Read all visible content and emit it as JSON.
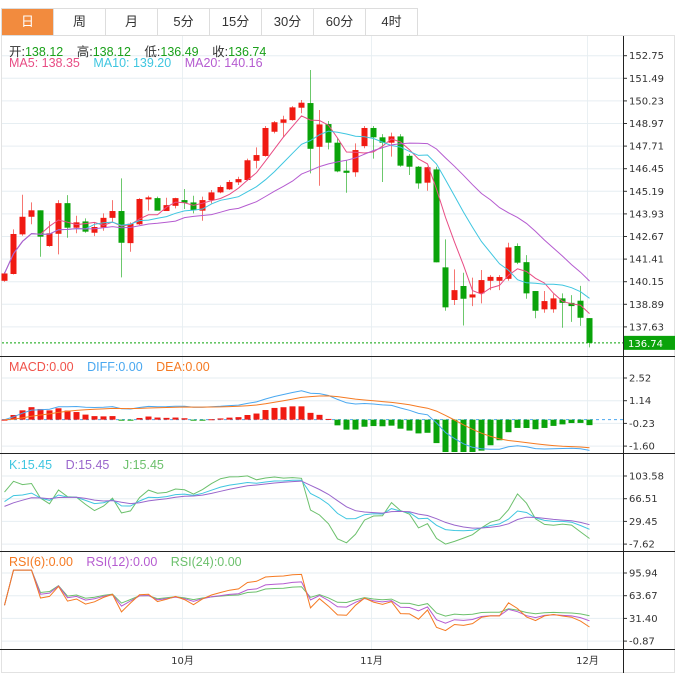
{
  "tabs": [
    {
      "label": "日",
      "active": true
    },
    {
      "label": "周",
      "active": false
    },
    {
      "label": "月",
      "active": false
    },
    {
      "label": "5分",
      "active": false
    },
    {
      "label": "15分",
      "active": false
    },
    {
      "label": "30分",
      "active": false
    },
    {
      "label": "60分",
      "active": false
    },
    {
      "label": "4时",
      "active": false
    }
  ],
  "ohlc_legend": {
    "open_label": "开:",
    "open": "138.12",
    "high_label": "高:",
    "high": "138.12",
    "low_label": "低:",
    "low": "136.49",
    "close_label": "收:",
    "close": "136.74"
  },
  "ma_legend": {
    "ma5": "MA5: 138.35",
    "ma10": "MA10: 139.20",
    "ma20": "MA20: 140.16"
  },
  "macd_legend": {
    "macd": "MACD:0.00",
    "diff": "DIFF:0.00",
    "dea": "DEA:0.00"
  },
  "kdj_legend": {
    "k": "K:15.45",
    "d": "D:15.45",
    "j": "J:15.45"
  },
  "rsi_legend": {
    "rsi6": "RSI(6):0.00",
    "rsi12": "RSI(12):0.00",
    "rsi24": "RSI(24):0.00"
  },
  "colors": {
    "up": "#F01A12",
    "down": "#0AA30A",
    "ma5": "#E84C84",
    "ma10": "#3FC6E0",
    "ma20": "#B55BD0",
    "diff": "#4AA8F0",
    "dea": "#F57A22",
    "k": "#3FC6E0",
    "d": "#9A66CC",
    "j": "#6CC06C",
    "rsi6": "#F57A22",
    "rsi12": "#B55BD0",
    "rsi24": "#6CC06C",
    "tab_active": "#F28B3E",
    "last_price_bg": "#0AA30A"
  },
  "chart_data": {
    "type": "candlestick",
    "candle_format": [
      "open",
      "high",
      "low",
      "close"
    ],
    "candles": [
      [
        140.2,
        140.69,
        140.15,
        140.61
      ],
      [
        140.58,
        143.07,
        140.55,
        142.81
      ],
      [
        142.79,
        145.0,
        142.71,
        143.77
      ],
      [
        143.77,
        144.57,
        143.35,
        144.13
      ],
      [
        144.13,
        144.13,
        141.54,
        142.66
      ],
      [
        142.14,
        143.53,
        142.1,
        142.85
      ],
      [
        142.82,
        144.7,
        141.67,
        144.53
      ],
      [
        144.53,
        144.98,
        142.6,
        143.16
      ],
      [
        143.16,
        143.83,
        142.85,
        143.46
      ],
      [
        143.51,
        143.68,
        142.88,
        142.94
      ],
      [
        142.88,
        143.44,
        142.69,
        143.2
      ],
      [
        143.18,
        143.96,
        142.99,
        143.71
      ],
      [
        143.71,
        144.7,
        143.49,
        144.09
      ],
      [
        144.09,
        145.91,
        140.39,
        142.32
      ],
      [
        142.3,
        143.46,
        141.82,
        143.38
      ],
      [
        143.35,
        144.81,
        143.31,
        144.76
      ],
      [
        144.74,
        144.94,
        144.11,
        144.85
      ],
      [
        144.81,
        144.89,
        144.11,
        144.11
      ],
      [
        144.09,
        144.83,
        144.09,
        144.42
      ],
      [
        144.38,
        144.83,
        144.24,
        144.81
      ],
      [
        144.7,
        145.32,
        144.2,
        144.55
      ],
      [
        144.57,
        144.94,
        143.96,
        144.14
      ],
      [
        144.11,
        144.89,
        143.55,
        144.7
      ],
      [
        144.69,
        145.26,
        144.52,
        145.13
      ],
      [
        145.13,
        145.52,
        145.08,
        145.43
      ],
      [
        145.3,
        145.82,
        145.26,
        145.71
      ],
      [
        145.69,
        146.0,
        145.54,
        145.87
      ],
      [
        145.82,
        147.01,
        145.78,
        146.92
      ],
      [
        146.89,
        147.64,
        146.47,
        147.21
      ],
      [
        147.16,
        148.83,
        147.12,
        148.72
      ],
      [
        148.51,
        149.11,
        148.42,
        149.04
      ],
      [
        149.01,
        149.4,
        148.2,
        149.2
      ],
      [
        149.16,
        149.94,
        149.12,
        149.87
      ],
      [
        149.85,
        150.28,
        149.54,
        150.13
      ],
      [
        150.11,
        151.95,
        146.19,
        147.56
      ],
      [
        147.67,
        149.72,
        145.5,
        148.92
      ],
      [
        148.94,
        149.11,
        147.53,
        147.9
      ],
      [
        147.9,
        148.14,
        146.25,
        146.3
      ],
      [
        146.34,
        146.93,
        145.11,
        146.22
      ],
      [
        146.25,
        147.86,
        146.0,
        147.49
      ],
      [
        147.71,
        148.83,
        147.59,
        148.72
      ],
      [
        148.72,
        148.83,
        147.01,
        148.2
      ],
      [
        148.2,
        148.38,
        145.71,
        147.9
      ],
      [
        147.9,
        148.46,
        147.12,
        148.25
      ],
      [
        148.25,
        148.38,
        146.56,
        146.62
      ],
      [
        147.17,
        147.27,
        146.1,
        146.56
      ],
      [
        146.56,
        146.6,
        145.33,
        145.63
      ],
      [
        145.67,
        146.56,
        145.22,
        146.53
      ],
      [
        146.41,
        146.56,
        141.23,
        141.23
      ],
      [
        140.95,
        142.51,
        138.53,
        138.72
      ],
      [
        139.13,
        140.84,
        138.85,
        139.68
      ],
      [
        139.91,
        140.65,
        137.71,
        139.2
      ],
      [
        139.27,
        140.38,
        138.79,
        139.44
      ],
      [
        139.5,
        140.8,
        138.94,
        140.24
      ],
      [
        140.2,
        140.52,
        139.68,
        140.42
      ],
      [
        140.2,
        140.52,
        139.68,
        140.41
      ],
      [
        140.31,
        142.32,
        140.2,
        142.06
      ],
      [
        142.14,
        142.29,
        141.13,
        141.21
      ],
      [
        141.24,
        141.63,
        139.2,
        139.5
      ],
      [
        139.63,
        139.63,
        138.11,
        138.53
      ],
      [
        138.61,
        139.63,
        138.42,
        139.07
      ],
      [
        138.61,
        139.46,
        138.42,
        139.22
      ],
      [
        139.22,
        139.5,
        137.58,
        138.97
      ],
      [
        138.97,
        139.4,
        137.91,
        138.79
      ],
      [
        139.09,
        139.92,
        137.69,
        138.14
      ],
      [
        138.12,
        138.12,
        136.49,
        136.74
      ]
    ],
    "moving_averages": [
      5,
      10,
      20
    ],
    "last_price": "136.74",
    "x_ticks": [
      {
        "label": "10月",
        "index": 20
      },
      {
        "label": "11月",
        "index": 41
      },
      {
        "label": "12月",
        "index": 65
      }
    ],
    "price_axis": {
      "ticks": [
        "152.75",
        "151.49",
        "150.23",
        "148.97",
        "147.71",
        "146.45",
        "145.19",
        "143.93",
        "142.67",
        "141.41",
        "140.15",
        "138.89",
        "137.63"
      ]
    },
    "macd_axis": {
      "ticks": [
        "2.52",
        "1.14",
        "-0.23",
        "-1.60"
      ]
    },
    "kdj_axis": {
      "ticks": [
        "103.58",
        "66.51",
        "29.45",
        "-7.62"
      ]
    },
    "rsi_axis": {
      "ticks": [
        "95.94",
        "63.67",
        "31.40",
        "-0.87"
      ]
    },
    "grid": true
  }
}
